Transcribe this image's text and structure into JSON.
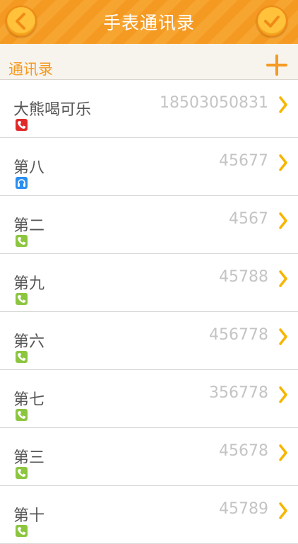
{
  "header": {
    "title": "手表通讯录",
    "back_icon": "chevron-left-icon",
    "confirm_icon": "checkmark-icon",
    "accent_color": "#f7a531"
  },
  "section": {
    "title": "通讯录",
    "add_icon": "plus-icon",
    "accent_color": "#f59a23"
  },
  "contacts": [
    {
      "name": "大熊喝可乐",
      "number": "18503050831",
      "type_icon": "phone-icon",
      "type_color": "#e02a2a"
    },
    {
      "name": "第八",
      "number": "45677",
      "type_icon": "headset-icon",
      "type_color": "#2a8ef0"
    },
    {
      "name": "第二",
      "number": "4567",
      "type_icon": "phone-icon",
      "type_color": "#8cc63f"
    },
    {
      "name": "第九",
      "number": "45788",
      "type_icon": "phone-icon",
      "type_color": "#8cc63f"
    },
    {
      "name": "第六",
      "number": "456778",
      "type_icon": "phone-icon",
      "type_color": "#8cc63f"
    },
    {
      "name": "第七",
      "number": "356778",
      "type_icon": "phone-icon",
      "type_color": "#8cc63f"
    },
    {
      "name": "第三",
      "number": "45678",
      "type_icon": "phone-icon",
      "type_color": "#8cc63f"
    },
    {
      "name": "第十",
      "number": "45789",
      "type_icon": "phone-icon",
      "type_color": "#8cc63f"
    }
  ]
}
